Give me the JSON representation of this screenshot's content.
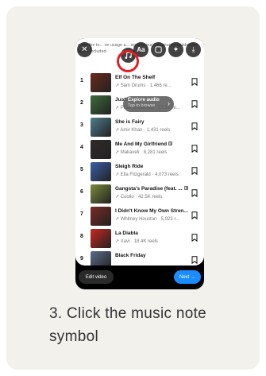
{
  "step_caption": "3. Click the music note symbol",
  "info_text": "s are the to...\nse usage a...\nagainst our Community Guidelines aren't included.",
  "explore": {
    "title": "Explore audio",
    "subtitle": "Tap to browse"
  },
  "songs": [
    {
      "rank": "1",
      "title": "Elf On The Shelf",
      "sub": "↗ Sam Drums · 1,466 re...",
      "color": "#6b2a1c"
    },
    {
      "rank": "2",
      "title": "Just for Me",
      "sub": "↗ PinkPantheress · 17.1K re...",
      "color": "#3d6b3a"
    },
    {
      "rank": "3",
      "title": "She is Fairy",
      "sub": "↗ Amir Khan · 1,431 reels",
      "color": "#4e7d8d"
    },
    {
      "rank": "4",
      "title": "Me And My Girlfriend",
      "badge": "E",
      "sub": "↗ Makaveli · 8,281 reels",
      "color": "#2f2a2a"
    },
    {
      "rank": "5",
      "title": "Sleigh Ride",
      "sub": "↗ Ella Fitzgerald · 4,073 reels",
      "color": "#3a5fa8"
    },
    {
      "rank": "6",
      "title": "Gangsta's Paradise (feat. ...",
      "badge": "E",
      "sub": "↗ Coolio · 42.5K reels",
      "color": "#7a8a3c"
    },
    {
      "rank": "7",
      "title": "I Didn't Know My Own Stren...",
      "sub": "↗ Whitney Houston · 5,923 r...",
      "color": "#7a2a22"
    },
    {
      "rank": "8",
      "title": "La Diabla",
      "sub": "↗ Xavi · 18.4K reels",
      "color": "#c8281e"
    },
    {
      "rank": "9",
      "title": "Black Friday",
      "sub": "",
      "color": "#5a6b8a"
    }
  ],
  "buttons": {
    "edit": "Edit video",
    "next": "Next →"
  }
}
